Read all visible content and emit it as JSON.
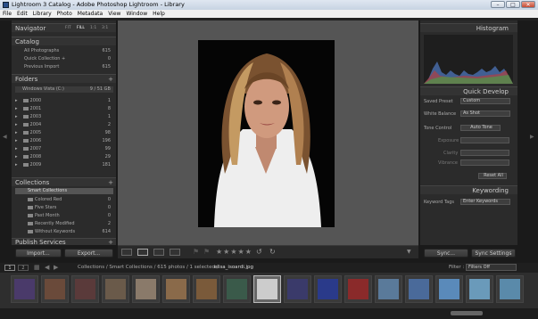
{
  "window": {
    "title": "Lightroom 3 Catalog - Adobe Photoshop Lightroom - Library"
  },
  "menu": [
    "File",
    "Edit",
    "Library",
    "Photo",
    "Metadata",
    "View",
    "Window",
    "Help"
  ],
  "navigator": {
    "title": "Navigator",
    "zoom": [
      "FIT",
      "FILL",
      "1:1",
      "3:1"
    ]
  },
  "catalog": {
    "title": "Catalog",
    "items": [
      {
        "label": "All Photographs",
        "count": "615"
      },
      {
        "label": "Quick Collection +",
        "count": "0"
      },
      {
        "label": "Previous Import",
        "count": "615"
      }
    ]
  },
  "folders": {
    "title": "Folders",
    "volume": "Windows Vista (C:)",
    "volume_info": "9 / 51 GB",
    "items": [
      {
        "label": "2000",
        "count": "1"
      },
      {
        "label": "2001",
        "count": "8"
      },
      {
        "label": "2003",
        "count": "1"
      },
      {
        "label": "2004",
        "count": "2"
      },
      {
        "label": "2005",
        "count": "98"
      },
      {
        "label": "2006",
        "count": "196"
      },
      {
        "label": "2007",
        "count": "99"
      },
      {
        "label": "2008",
        "count": "29"
      },
      {
        "label": "2009",
        "count": "181"
      }
    ]
  },
  "collections": {
    "title": "Collections",
    "group": "Smart Collections",
    "items": [
      {
        "label": "Colored Red",
        "count": "0"
      },
      {
        "label": "Five Stars",
        "count": "0"
      },
      {
        "label": "Past Month",
        "count": "0"
      },
      {
        "label": "Recently Modified",
        "count": "2"
      },
      {
        "label": "Without Keywords",
        "count": "614"
      }
    ]
  },
  "publish": {
    "title": "Publish Services"
  },
  "buttons": {
    "import": "Import...",
    "export": "Export...",
    "sync": "Sync...",
    "sync_settings": "Sync Settings"
  },
  "histogram": {
    "title": "Histogram"
  },
  "quick_develop": {
    "title": "Quick Develop",
    "saved_preset_label": "Saved Preset",
    "saved_preset": "Custom",
    "white_balance_label": "White Balance",
    "white_balance": "As Shot",
    "tone_label": "Tone Control",
    "auto_tone": "Auto Tone",
    "sliders": [
      "Exposure",
      "Clarity",
      "Vibrance"
    ],
    "reset": "Reset All"
  },
  "keywording": {
    "title": "Keywording",
    "tags_label": "Keyword Tags",
    "tags_value": "Enter Keywords"
  },
  "filmstrip": {
    "pages": [
      "1",
      "2"
    ],
    "path": "Collections / Smart Collections / 615 photos / 1 selected / ",
    "file": "elisa_isoardi.jpg",
    "filter_label": "Filter :",
    "filter_value": "Filters Off",
    "thumbs": 12
  },
  "toolbar": {
    "stars": "★★★★★"
  }
}
